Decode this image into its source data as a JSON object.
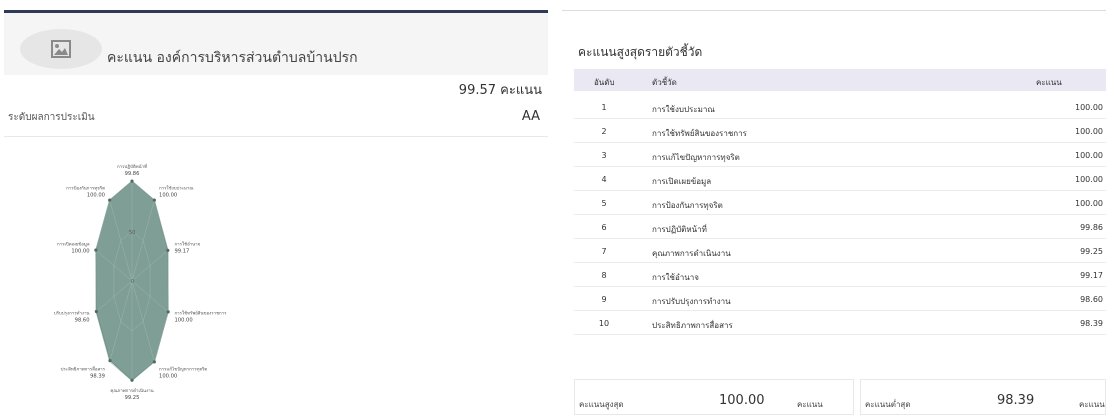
{
  "left": {
    "title": "คะแนน องค์การบริหารส่วนตำบลบ้านปรก",
    "score": "99.57",
    "score_unit": "คะแนน",
    "level_label": "ระดับผลการประเมิน",
    "level_value": "AA"
  },
  "radar": {
    "ring_labels": [
      "50",
      "0"
    ],
    "axes": [
      {
        "label": "การปฏิบัติหน้าที่",
        "value": "99.86"
      },
      {
        "label": "การใช้งบประมาณ",
        "value": "100.00"
      },
      {
        "label": "การใช้อำนาจ",
        "value": "99.17"
      },
      {
        "label": "การใช้ทรัพย์สินของราชการ",
        "value": "100.00"
      },
      {
        "label": "การแก้ไขปัญหาการทุจริต",
        "value": "100.00"
      },
      {
        "label": "คุณภาพการดำเนินงาน",
        "value": "99.25"
      },
      {
        "label": "ประสิทธิภาพการสื่อสาร",
        "value": "98.39"
      },
      {
        "label": "การปรับปรุงการทำงาน",
        "value": "98.60"
      },
      {
        "label": "การเปิดเผยข้อมูล",
        "value": "100.00"
      },
      {
        "label": "การป้องกันการทุจริต",
        "value": "100.00"
      }
    ],
    "fill_color": "#7f9e96"
  },
  "right": {
    "title": "คะแนนสูงสุดรายตัวชี้วัด",
    "headers": {
      "rank": "อันดับ",
      "indicator": "ตัวชี้วัด",
      "score": "คะแนน"
    },
    "rows": [
      {
        "rank": "1",
        "name": "การใช้งบประมาณ",
        "score": "100.00"
      },
      {
        "rank": "2",
        "name": "การใช้ทรัพย์สินของราชการ",
        "score": "100.00"
      },
      {
        "rank": "3",
        "name": "การแก้ไขปัญหาการทุจริต",
        "score": "100.00"
      },
      {
        "rank": "4",
        "name": "การเปิดเผยข้อมูล",
        "score": "100.00"
      },
      {
        "rank": "5",
        "name": "การป้องกันการทุจริต",
        "score": "100.00"
      },
      {
        "rank": "6",
        "name": "การปฏิบัติหน้าที่",
        "score": "99.86"
      },
      {
        "rank": "7",
        "name": "คุณภาพการดำเนินงาน",
        "score": "99.25"
      },
      {
        "rank": "8",
        "name": "การใช้อำนาจ",
        "score": "99.17"
      },
      {
        "rank": "9",
        "name": "การปรับปรุงการทำงาน",
        "score": "98.60"
      },
      {
        "rank": "10",
        "name": "ประสิทธิภาพการสื่อสาร",
        "score": "98.39"
      }
    ],
    "max_summary": {
      "label": "คะแนนสูงสุด",
      "value": "100.00",
      "unit": "คะแนน"
    },
    "min_summary": {
      "label": "คะแนนต่ำสุด",
      "value": "98.39",
      "unit": "คะแนน"
    }
  }
}
